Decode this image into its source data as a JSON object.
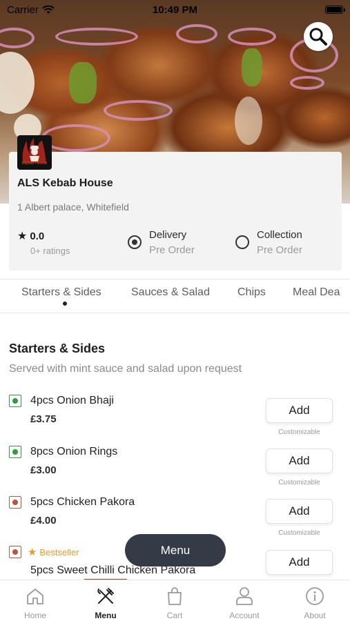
{
  "status_bar": {
    "carrier": "Carrier",
    "time": "10:49 PM"
  },
  "restaurant": {
    "name": "ALS Kebab House",
    "address": "1 Albert palace, Whitefield",
    "rating": "0.0",
    "rating_count": "0+ ratings",
    "logo_text": "Kebab House"
  },
  "order_options": [
    {
      "label": "Delivery",
      "sub": "Pre Order",
      "selected": true
    },
    {
      "label": "Collection",
      "sub": "Pre Order",
      "selected": false
    }
  ],
  "tabs": [
    {
      "label": "Starters & Sides",
      "active": true
    },
    {
      "label": "Sauces & Salad",
      "active": false
    },
    {
      "label": "Chips",
      "active": false
    },
    {
      "label": "Meal Dea",
      "active": false
    }
  ],
  "section": {
    "title": "Starters & Sides",
    "subtitle": "Served with mint sauce and salad upon request"
  },
  "items": [
    {
      "name": "4pcs Onion Bhaji",
      "price": "£3.75",
      "veg": true,
      "add_label": "Add",
      "custom_label": "Customizable"
    },
    {
      "name": "8pcs Onion Rings",
      "price": "£3.00",
      "veg": true,
      "add_label": "Add",
      "custom_label": "Customizable"
    },
    {
      "name": "5pcs Chicken Pakora",
      "price": "£4.00",
      "veg": false,
      "add_label": "Add",
      "custom_label": "Customizable"
    },
    {
      "name": "5pcs Sweet Chilli Chicken Pakora",
      "price": "",
      "veg": false,
      "add_label": "Add",
      "badge": "Bestseller"
    }
  ],
  "menu_button": "Menu",
  "bottom_nav": [
    {
      "label": "Home",
      "icon": "home-icon",
      "active": false
    },
    {
      "label": "Menu",
      "icon": "fork-knife-icon",
      "active": true
    },
    {
      "label": "Cart",
      "icon": "bag-icon",
      "active": false
    },
    {
      "label": "Account",
      "icon": "user-icon",
      "active": false
    },
    {
      "label": "About",
      "icon": "info-icon",
      "active": false
    }
  ],
  "colors": {
    "veg_green": "#2e9d3a",
    "nonveg_brown": "#b7573a",
    "bestseller": "#e89a26",
    "menu_pill": "#353a47",
    "active_underline": "#d22b2b"
  }
}
